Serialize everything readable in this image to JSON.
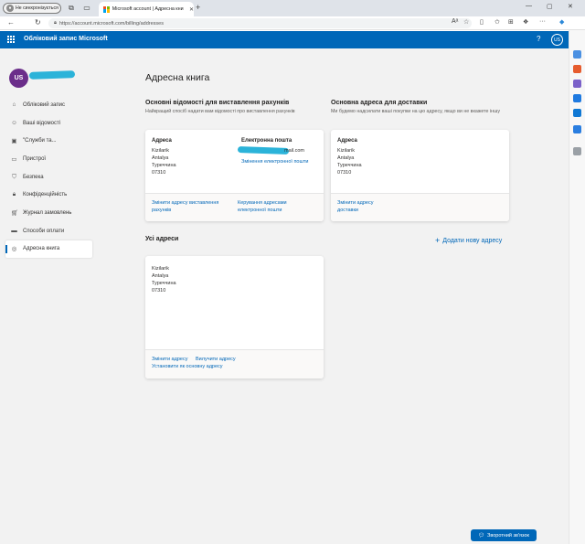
{
  "browser": {
    "profile_label": "Не синхронізується",
    "tab_title": "Microsoft account | Адресна кни",
    "url": "https://account.microsoft.com/billing/addresses"
  },
  "header": {
    "title": "Обліковий запис Microsoft",
    "help": "?",
    "avatar_initials": "US"
  },
  "sidebar": {
    "avatar_initials": "US",
    "items": [
      {
        "label": "Обліковий запис",
        "icon": "home-icon"
      },
      {
        "label": "Ваші відомості",
        "icon": "person-icon"
      },
      {
        "label": "\"Служби та...",
        "icon": "box-icon"
      },
      {
        "label": "Пристрої",
        "icon": "laptop-icon"
      },
      {
        "label": "Безпека",
        "icon": "shield-icon"
      },
      {
        "label": "Конфіденційність",
        "icon": "lock-icon"
      },
      {
        "label": "Журнал замовлень",
        "icon": "cart-icon"
      },
      {
        "label": "Способи оплати",
        "icon": "card-icon"
      },
      {
        "label": "Адресна книга",
        "icon": "location-icon",
        "active": true
      }
    ]
  },
  "main": {
    "page_title": "Адресна книга",
    "billing": {
      "title": "Основні відомості для виставлення рахунків",
      "subtitle": "Найкращий спосіб надати вам відомості про виставлення рахунків",
      "address_label": "Адреса",
      "address_lines": [
        "Kizilarik",
        "Antalya",
        "Туреччина",
        "07310"
      ],
      "email_label": "Електронна пошта",
      "email_suffix": "mail.com",
      "change_email_link": "Змінення електронної пошти",
      "change_address_link": "Змінити адресу виставлення рахунків",
      "manage_addresses_link": "Керування адресами електронної пошти"
    },
    "shipping": {
      "title": "Основна адреса для доставки",
      "subtitle": "Ми будемо надсилати ваші покупки на цю адресу, якщо ви не вкажете іншу",
      "address_label": "Адреса",
      "address_lines": [
        "Kizilarik",
        "Antalya",
        "Туреччина",
        "07310"
      ],
      "change_link": "Змінити адресу доставки"
    },
    "all_addresses": {
      "title": "Усі адреси",
      "add_new": "Додати нову адресу",
      "address_lines": [
        "Kizilarik",
        "Antalya",
        "Туреччина",
        "07310"
      ],
      "edit_link": "Змінити адресу",
      "delete_link": "Вилучити адресу",
      "set_primary_link": "Установити як основну адресу"
    }
  },
  "feedback_button": "Зворотний зв'язок",
  "colors": {
    "brand": "#0067b8",
    "avatar": "#6b2e8a"
  }
}
